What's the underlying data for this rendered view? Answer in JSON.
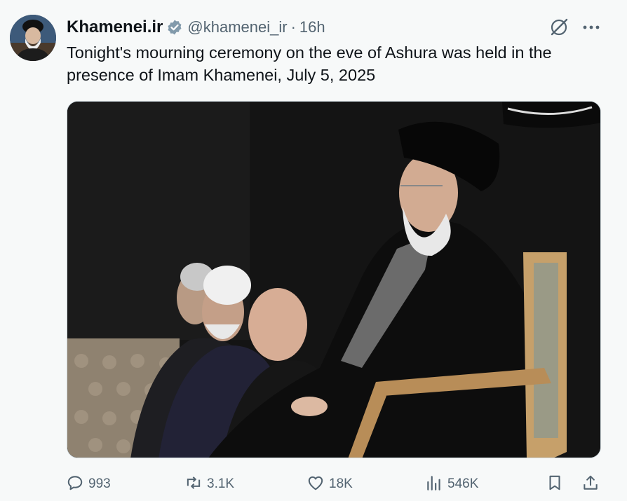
{
  "author": {
    "display_name": "Khamenei.ir",
    "handle": "@khamenei_ir",
    "separator": "·",
    "timestamp": "16h",
    "avatar_icon": "avatar-portrait",
    "verified_icon": "verified-badge-icon"
  },
  "post": {
    "text": "Tonight's mourning ceremony on the eve of Ashura was held in the presence of Imam Khamenei, July 5, 2025"
  },
  "top_actions": [
    {
      "icon": "grok-icon"
    },
    {
      "icon": "more-icon"
    }
  ],
  "stats": {
    "replies": "993",
    "reposts": "3.1K",
    "likes": "18K",
    "views": "546K"
  },
  "colors": {
    "text_primary": "#0f1419",
    "text_secondary": "#536471",
    "background": "#f7f9f9",
    "verified_badge": "#829aab"
  }
}
